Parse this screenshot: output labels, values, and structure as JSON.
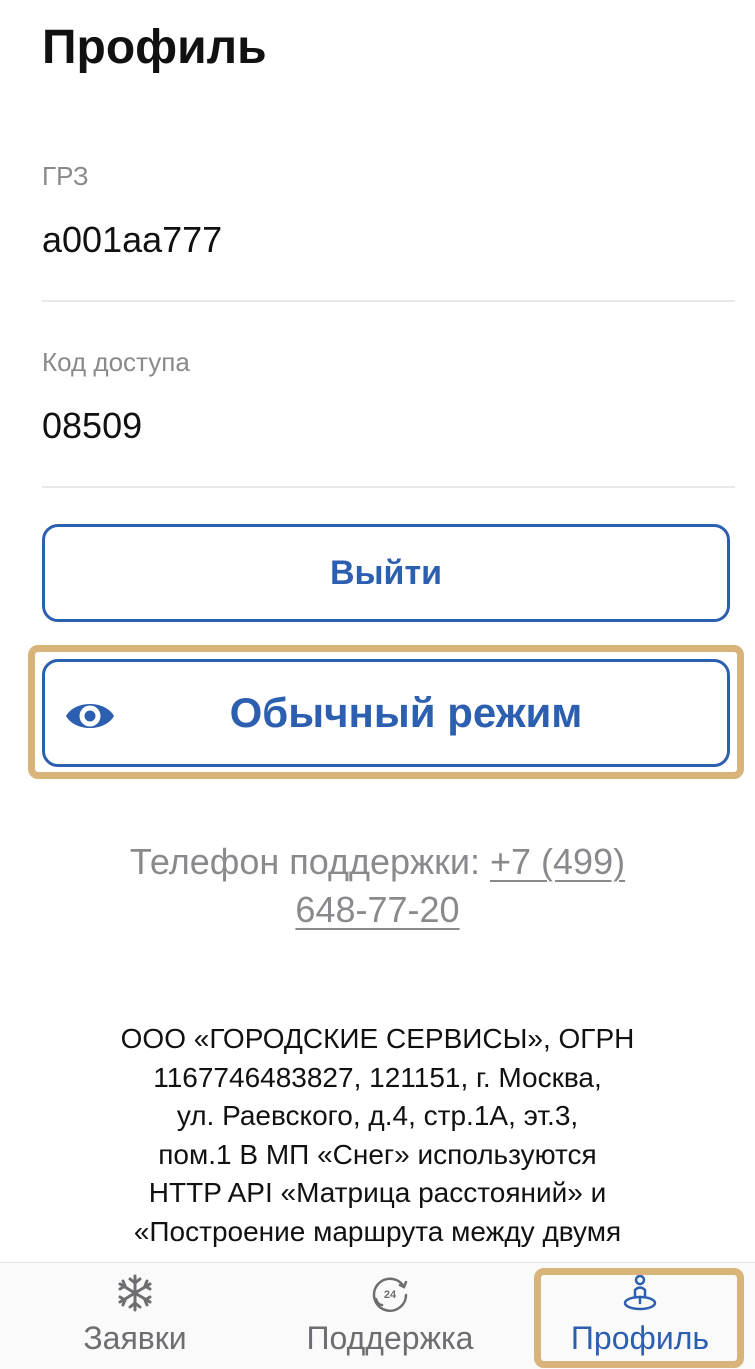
{
  "header": {
    "title": "Профиль"
  },
  "fields": {
    "plate": {
      "label": "ГРЗ",
      "value": "a001aa777"
    },
    "access_code": {
      "label": "Код доступа",
      "value": "08509"
    }
  },
  "buttons": {
    "logout_label": "Выйти",
    "mode_label": "Обычный режим"
  },
  "support": {
    "label": "Телефон поддержки:",
    "phone_part1": "+7 (499)",
    "phone_part2": "648-77-20"
  },
  "legal": {
    "lines": [
      "ООО «ГОРОДСКИЕ СЕРВИСЫ», ОГРН",
      "1167746483827, 121151, г. Москва,",
      "ул. Раевского, д.4, стр.1А, эт.3,",
      "пом.1 В МП «Снег» используются",
      "HTTP API «Матрица расстояний» и",
      "«Построение маршрута между двумя"
    ]
  },
  "tabbar": {
    "tabs": [
      {
        "label": "Заявки",
        "icon": "snowflake-icon"
      },
      {
        "label": "Поддержка",
        "icon": "support-24-icon"
      },
      {
        "label": "Профиль",
        "icon": "profile-location-icon",
        "active": true
      }
    ]
  },
  "colors": {
    "accent": "#2d5fb0",
    "highlight": "#d8b47a",
    "muted_text": "#8a8a8e",
    "divider": "#e9e9ec"
  }
}
